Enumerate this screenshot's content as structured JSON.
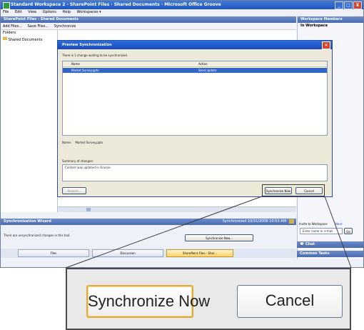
{
  "window": {
    "title": "Standard Workspace 2 · SharePoint Files · Shared Documents · Microsoft Office Groove",
    "controls": [
      "_",
      "□",
      "X"
    ],
    "menu": [
      "File",
      "Edit",
      "View",
      "Options",
      "Help",
      "Workspaces ▾"
    ]
  },
  "left_panel": {
    "header": "SharePoint Files - Shared Documents",
    "toolbar": [
      "Add Files...",
      "Save Files...",
      "Synchronize"
    ],
    "tree_header": "Folders",
    "tree_items": [
      "Shared Documents"
    ]
  },
  "right_panel": {
    "header": "Workspace Members",
    "in_workspace": "In Workspace",
    "info_text": [
      "... configuration",
      "... are a ... not",
      "... name below ... to"
    ],
    "invite_label": "Invite to Workspace",
    "invite_link": "Next",
    "invite_placeholder": "Enter name or e-mail",
    "invite_button": "Go",
    "chat_label": "Chat",
    "common_tasks_label": "Common Tasks"
  },
  "dialog": {
    "title": "Preview Synchronization",
    "message": "There is 1 change waiting to be synchronized.",
    "columns": [
      "Name",
      "Action"
    ],
    "rows": [
      {
        "name": "Market Survey.pptx",
        "action": "Send update"
      }
    ],
    "name_label": "Name:",
    "name_value": "Market Survey.pptx",
    "summary_label": "Summary of changes:",
    "summary_text": "Content was updated in Groove.",
    "restore_button": "Restore...",
    "sync_button": "Synchronize Now",
    "cancel_button": "Cancel"
  },
  "sync_bar": {
    "header": "Synchronization Wizard",
    "timestamp": "Synchronized 10/31/2006 10:53 AM",
    "message": "There are unsynchronized changes in this tool.",
    "button": "Synchronize Now..."
  },
  "tabs": [
    "Files",
    "Discussion",
    "SharePoint Files - Shar..."
  ],
  "zoom": {
    "sync_button": "Synchronize Now",
    "cancel_button": "Cancel"
  },
  "colors": {
    "title_blue": "#1f55c2",
    "selection_blue": "#3166c7",
    "focus_orange": "#e0a93b",
    "close_red": "#d0452f"
  }
}
